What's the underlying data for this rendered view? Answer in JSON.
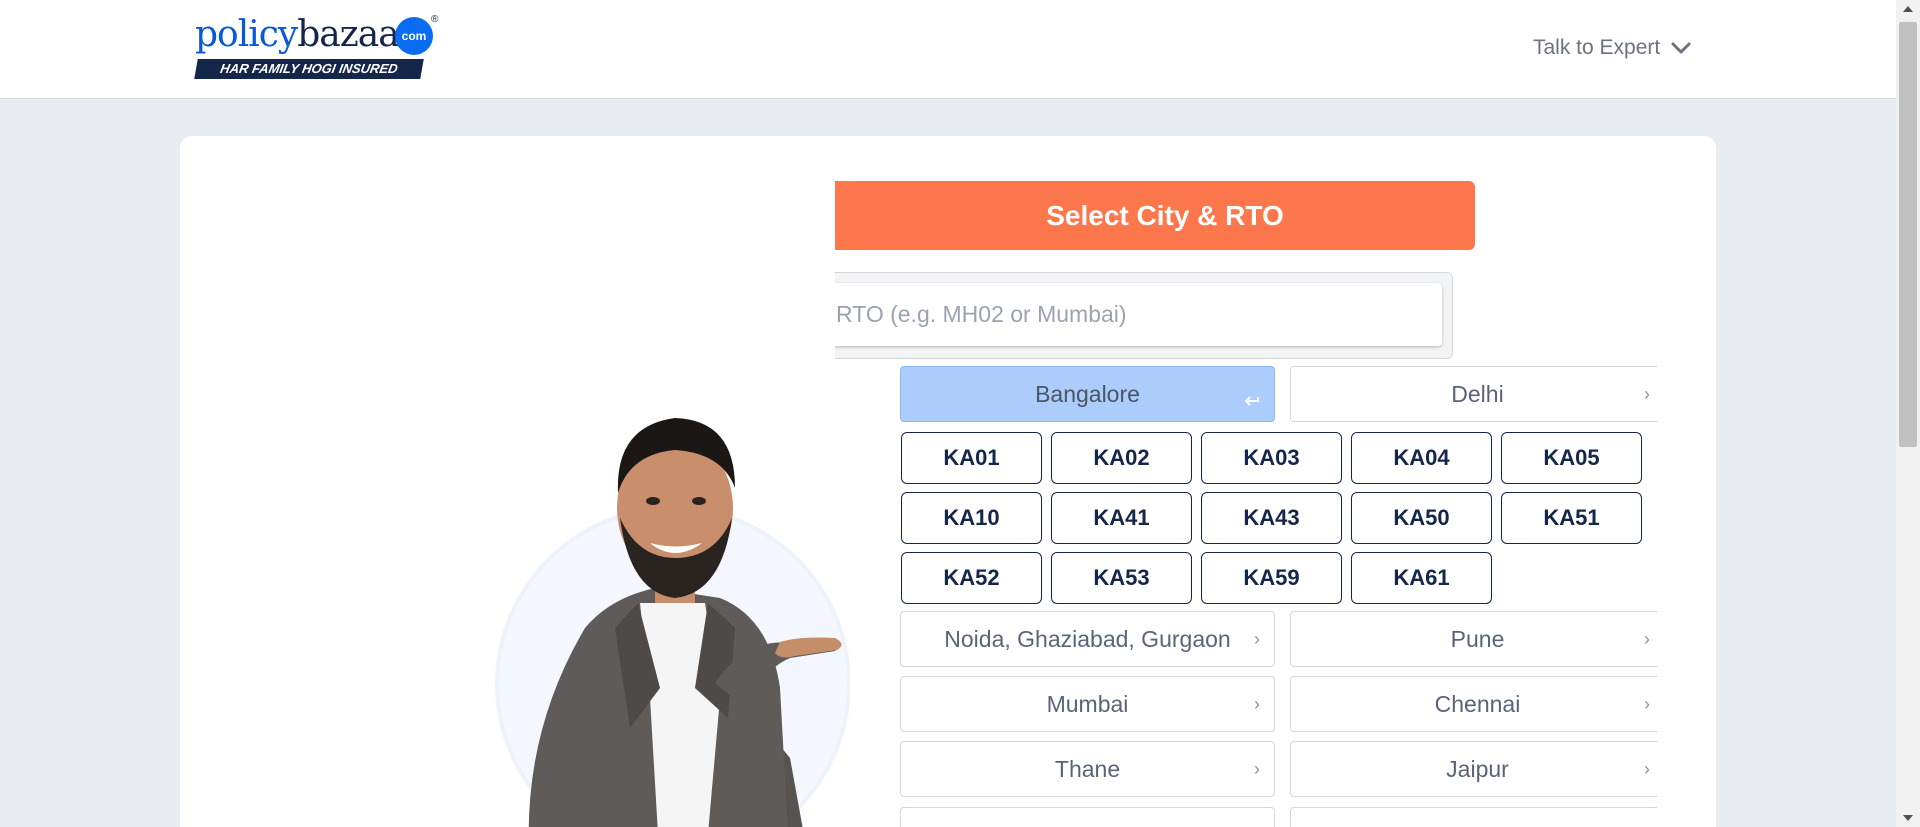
{
  "header": {
    "logo_word1": "policy",
    "logo_word2": "bazaar",
    "logo_dotcom": "com",
    "logo_registered": "®",
    "logo_tagline": "HAR FAMILY HOGI INSURED",
    "expert_label": "Talk to Expert"
  },
  "panel": {
    "title": "Select City & RTO",
    "search_placeholder": "RTO (e.g. MH02 or Mumbai)"
  },
  "cities": [
    {
      "label": "Bangalore",
      "selected": true
    },
    {
      "label": "Delhi",
      "selected": false
    },
    {
      "label": "Noida, Ghaziabad, Gurgaon",
      "selected": false
    },
    {
      "label": "Pune",
      "selected": false
    },
    {
      "label": "Mumbai",
      "selected": false
    },
    {
      "label": "Chennai",
      "selected": false
    },
    {
      "label": "Thane",
      "selected": false
    },
    {
      "label": "Jaipur",
      "selected": false
    }
  ],
  "rto_codes": [
    "KA01",
    "KA02",
    "KA03",
    "KA04",
    "KA05",
    "KA10",
    "KA41",
    "KA43",
    "KA50",
    "KA51",
    "KA52",
    "KA53",
    "KA59",
    "KA61"
  ],
  "icons": {
    "expert_dropdown": "chevron-down-icon",
    "city_arrow": "chevron-right-icon",
    "selected_city": "return-arrow-icon"
  },
  "colors": {
    "brand_blue": "#0a59d6",
    "brand_navy": "#14264a",
    "cta_orange": "#fc774c",
    "selected_city_bg": "#acccfc"
  }
}
